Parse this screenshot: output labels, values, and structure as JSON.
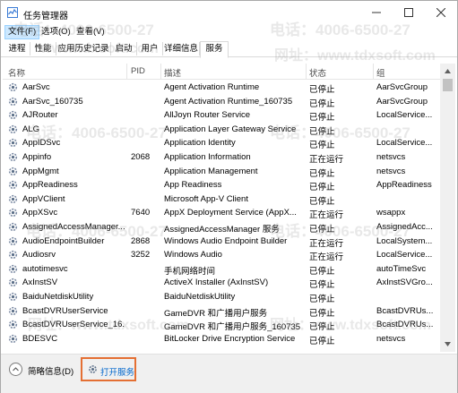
{
  "window": {
    "title": "任务管理器"
  },
  "menu": [
    {
      "label": "文件(F)",
      "active": true
    },
    {
      "label": "选项(O)",
      "active": false
    },
    {
      "label": "查看(V)",
      "active": false
    }
  ],
  "tabs": [
    {
      "label": "进程"
    },
    {
      "label": "性能"
    },
    {
      "label": "应用历史记录"
    },
    {
      "label": "启动"
    },
    {
      "label": "用户"
    },
    {
      "label": "详细信息"
    },
    {
      "label": "服务"
    }
  ],
  "active_tab": "服务",
  "columns": [
    "名称",
    "PID",
    "描述",
    "状态",
    "组"
  ],
  "rows": [
    {
      "name": "AarSvc",
      "pid": "",
      "desc": "Agent Activation Runtime",
      "status": "已停止",
      "group": "AarSvcGroup"
    },
    {
      "name": "AarSvc_160735",
      "pid": "",
      "desc": "Agent Activation Runtime_160735",
      "status": "已停止",
      "group": "AarSvcGroup"
    },
    {
      "name": "AJRouter",
      "pid": "",
      "desc": "AllJoyn Router Service",
      "status": "已停止",
      "group": "LocalService..."
    },
    {
      "name": "ALG",
      "pid": "",
      "desc": "Application Layer Gateway Service",
      "status": "已停止",
      "group": ""
    },
    {
      "name": "AppIDSvc",
      "pid": "",
      "desc": "Application Identity",
      "status": "已停止",
      "group": "LocalService..."
    },
    {
      "name": "Appinfo",
      "pid": "2068",
      "desc": "Application Information",
      "status": "正在运行",
      "group": "netsvcs"
    },
    {
      "name": "AppMgmt",
      "pid": "",
      "desc": "Application Management",
      "status": "已停止",
      "group": "netsvcs"
    },
    {
      "name": "AppReadiness",
      "pid": "",
      "desc": "App Readiness",
      "status": "已停止",
      "group": "AppReadiness"
    },
    {
      "name": "AppVClient",
      "pid": "",
      "desc": "Microsoft App-V Client",
      "status": "已停止",
      "group": ""
    },
    {
      "name": "AppXSvc",
      "pid": "7640",
      "desc": "AppX Deployment Service (AppX...",
      "status": "正在运行",
      "group": "wsappx"
    },
    {
      "name": "AssignedAccessManager...",
      "pid": "",
      "desc": "AssignedAccessManager 服务",
      "status": "已停止",
      "group": "AssignedAcc..."
    },
    {
      "name": "AudioEndpointBuilder",
      "pid": "2868",
      "desc": "Windows Audio Endpoint Builder",
      "status": "正在运行",
      "group": "LocalSystem..."
    },
    {
      "name": "Audiosrv",
      "pid": "3252",
      "desc": "Windows Audio",
      "status": "正在运行",
      "group": "LocalService..."
    },
    {
      "name": "autotimesvc",
      "pid": "",
      "desc": "手机网络时间",
      "status": "已停止",
      "group": "autoTimeSvc"
    },
    {
      "name": "AxInstSV",
      "pid": "",
      "desc": "ActiveX Installer (AxInstSV)",
      "status": "已停止",
      "group": "AxInstSVGro..."
    },
    {
      "name": "BaiduNetdiskUtility",
      "pid": "",
      "desc": "BaiduNetdiskUtility",
      "status": "已停止",
      "group": ""
    },
    {
      "name": "BcastDVRUserService",
      "pid": "",
      "desc": "GameDVR 和广播用户服务",
      "status": "已停止",
      "group": "BcastDVRUs..."
    },
    {
      "name": "BcastDVRUserService_16...",
      "pid": "",
      "desc": "GameDVR 和广播用户服务_160735",
      "status": "已停止",
      "group": "BcastDVRUs..."
    },
    {
      "name": "BDESVC",
      "pid": "",
      "desc": "BitLocker Drive Encryption Service",
      "status": "已停止",
      "group": "netsvcs"
    }
  ],
  "footer": {
    "fewer_details": "简略信息(D)",
    "open_services": "打开服务"
  },
  "watermark": {
    "phone": "电话：4006-6500-27",
    "phone_short": "4006-6500-27",
    "site": "网址：www.tdxsoft.com",
    "site_short": "www.tdxsoft.com"
  },
  "colors": {
    "accent_border": "#e46f33",
    "link": "#0066cc",
    "icon_blue": "#3a7bd5",
    "menu_active": "#cce8ff"
  }
}
